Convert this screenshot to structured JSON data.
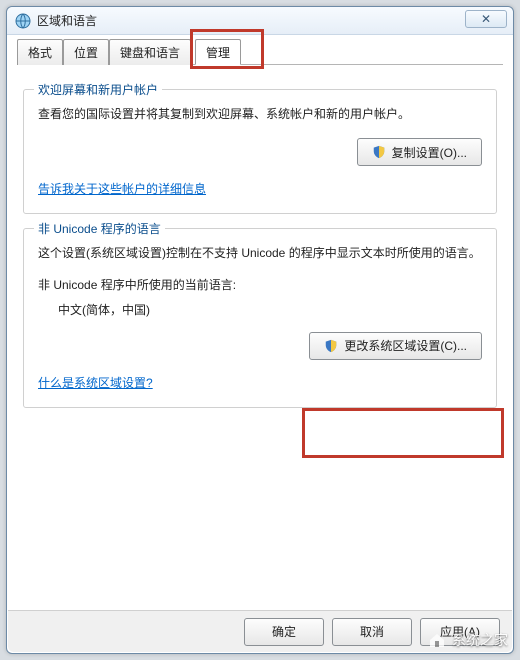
{
  "window": {
    "title": "区域和语言",
    "close_symbol": "✕"
  },
  "tabs": {
    "format": "格式",
    "location": "位置",
    "keyboard": "键盘和语言",
    "admin": "管理"
  },
  "group1": {
    "legend": "欢迎屏幕和新用户帐户",
    "desc": "查看您的国际设置并将其复制到欢迎屏幕、系统帐户和新的用户帐户。",
    "copy_btn": "复制设置(O)...",
    "link": "告诉我关于这些帐户的详细信息"
  },
  "group2": {
    "legend": "非 Unicode 程序的语言",
    "desc": "这个设置(系统区域设置)控制在不支持 Unicode 的程序中显示文本时所使用的语言。",
    "current_label": "非 Unicode 程序中所使用的当前语言:",
    "current_value": "中文(简体，中国)",
    "change_btn": "更改系统区域设置(C)...",
    "link": "什么是系统区域设置?"
  },
  "buttons": {
    "ok": "确定",
    "cancel": "取消",
    "apply": "应用(A)"
  },
  "watermark": "系统之家"
}
